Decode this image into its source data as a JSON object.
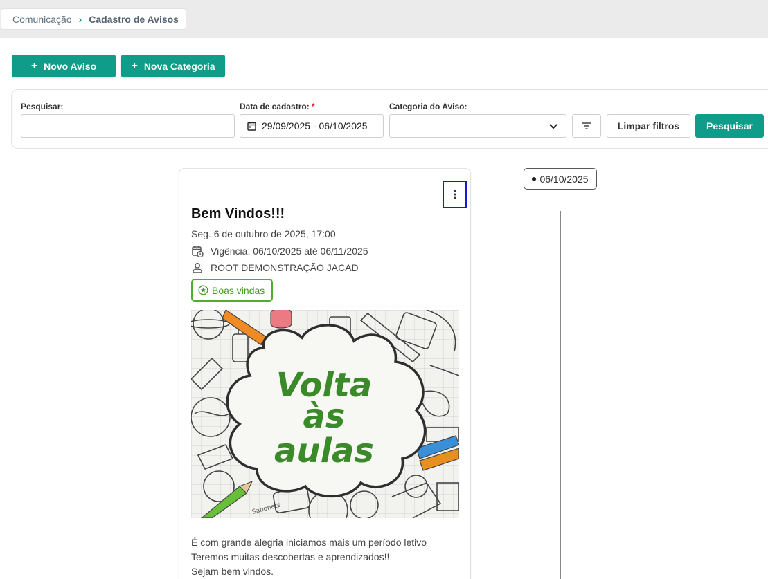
{
  "breadcrumb": {
    "parent": "Comunicação",
    "current": "Cadastro de Avisos"
  },
  "actions": {
    "new_notice": "Novo Aviso",
    "new_category": "Nova Categoria"
  },
  "filters": {
    "search_label": "Pesquisar:",
    "search_value": "",
    "date_label": "Data de cadastro:",
    "date_required": "*",
    "date_value": "29/09/2025 - 06/10/2025",
    "category_label": "Categoria do Aviso:",
    "category_value": "",
    "clear_label": "Limpar filtros",
    "search_button": "Pesquisar"
  },
  "timeline": {
    "date": "06/10/2025"
  },
  "notice": {
    "title": "Bem Vindos!!!",
    "published": "Seg. 6 de outubro de 2025, 17:00",
    "validity": "Vigência: 06/10/2025 até 06/11/2025",
    "author": "ROOT DEMONSTRAÇÃO JACAD",
    "category_tag": "Boas vindas",
    "image": {
      "line1": "Volta",
      "line2": "às",
      "line3": "aulas",
      "label": "Sabonete"
    },
    "body": [
      "É com grande alegria iniciamos mais um período letivo",
      "Teremos muitas descobertas e aprendizados!!",
      "Sejam bem vindos."
    ]
  },
  "colors": {
    "primary": "#0f9d8a",
    "tag_green": "#4caf2c",
    "focus_border": "#1a1ad6"
  }
}
